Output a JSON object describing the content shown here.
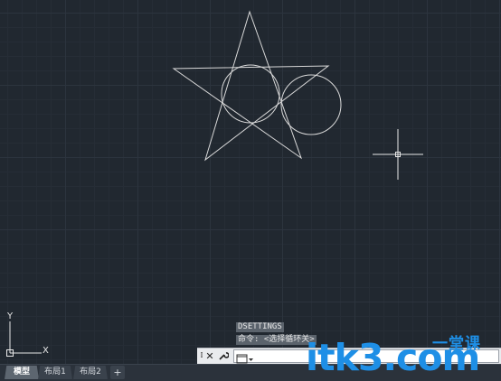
{
  "command_history": [
    "DSETTINGS",
    "命令: <选择循环关>"
  ],
  "command_input": {
    "value": "",
    "placeholder": ""
  },
  "layout_tabs": [
    {
      "label": "模型",
      "active": true
    },
    {
      "label": "布局1",
      "active": false
    },
    {
      "label": "布局2",
      "active": false
    }
  ],
  "add_tab_label": "+",
  "ucs_icon": {
    "x_label": "X",
    "y_label": "Y"
  },
  "watermark": {
    "main": "itk3",
    "sub": "一堂课",
    "domain": ".com"
  },
  "colors": {
    "background": "#212830",
    "geometry": "#d9d9d9",
    "watermark": "#1e8fe6"
  },
  "icons": [
    "close-icon",
    "wrench-icon",
    "command-prompt-icon",
    "crosshair-cursor-icon"
  ]
}
